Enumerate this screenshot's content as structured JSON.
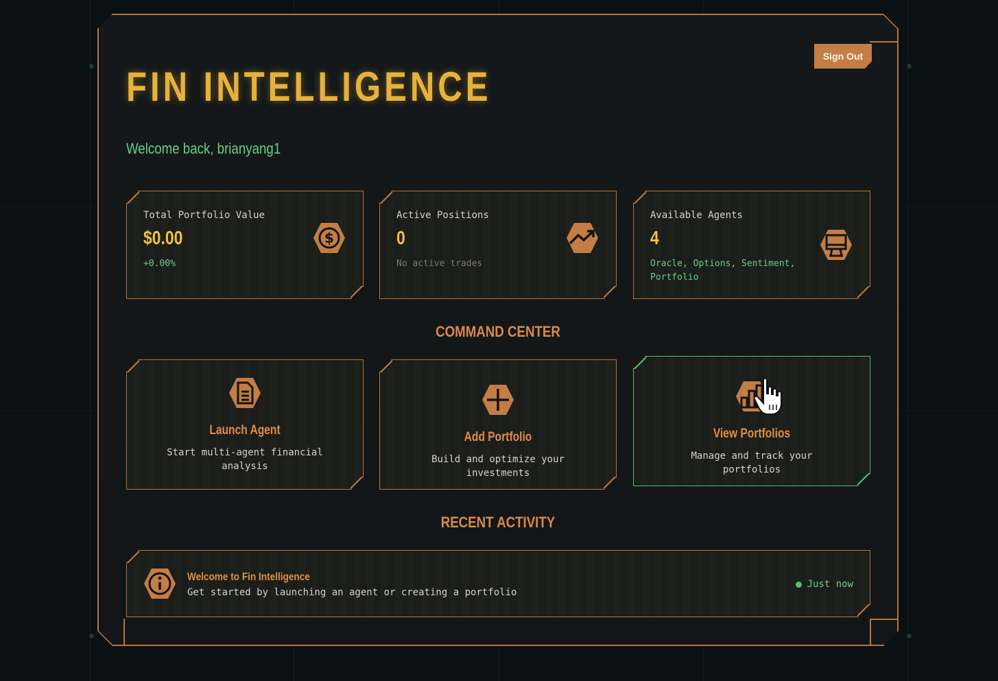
{
  "app": {
    "title": "FIN INTELLIGENCE",
    "welcome": "Welcome back, brianyang1",
    "sign_out_label": "Sign Out"
  },
  "stats": [
    {
      "label": "Total Portfolio Value",
      "value": "$0.00",
      "sub": "+0.00%",
      "icon": "dollar-icon"
    },
    {
      "label": "Active Positions",
      "value": "0",
      "sub": "No active trades",
      "icon": "trending-up-icon"
    },
    {
      "label": "Available Agents",
      "value": "4",
      "sub": "Oracle, Options, Sentiment, Portfolio",
      "icon": "monitor-icon"
    }
  ],
  "command_center": {
    "title": "COMMAND CENTER",
    "actions": [
      {
        "title": "Launch Agent",
        "desc": "Start multi-agent financial analysis",
        "icon": "document-icon"
      },
      {
        "title": "Add Portfolio",
        "desc": "Build and optimize your investments",
        "icon": "plus-icon"
      },
      {
        "title": "View Portfolios",
        "desc": "Manage and track your portfolios",
        "icon": "bar-chart-icon"
      }
    ]
  },
  "recent_activity": {
    "title": "RECENT ACTIVITY",
    "items": [
      {
        "title": "Welcome to Fin Intelligence",
        "desc": "Get started by launching an agent or creating a portfolio",
        "time": "Just now",
        "icon": "info-icon"
      }
    ]
  },
  "colors": {
    "accent": "#c47d45",
    "title_gold": "#e6b23c",
    "positive": "#66d08a",
    "background": "#0b1013"
  }
}
